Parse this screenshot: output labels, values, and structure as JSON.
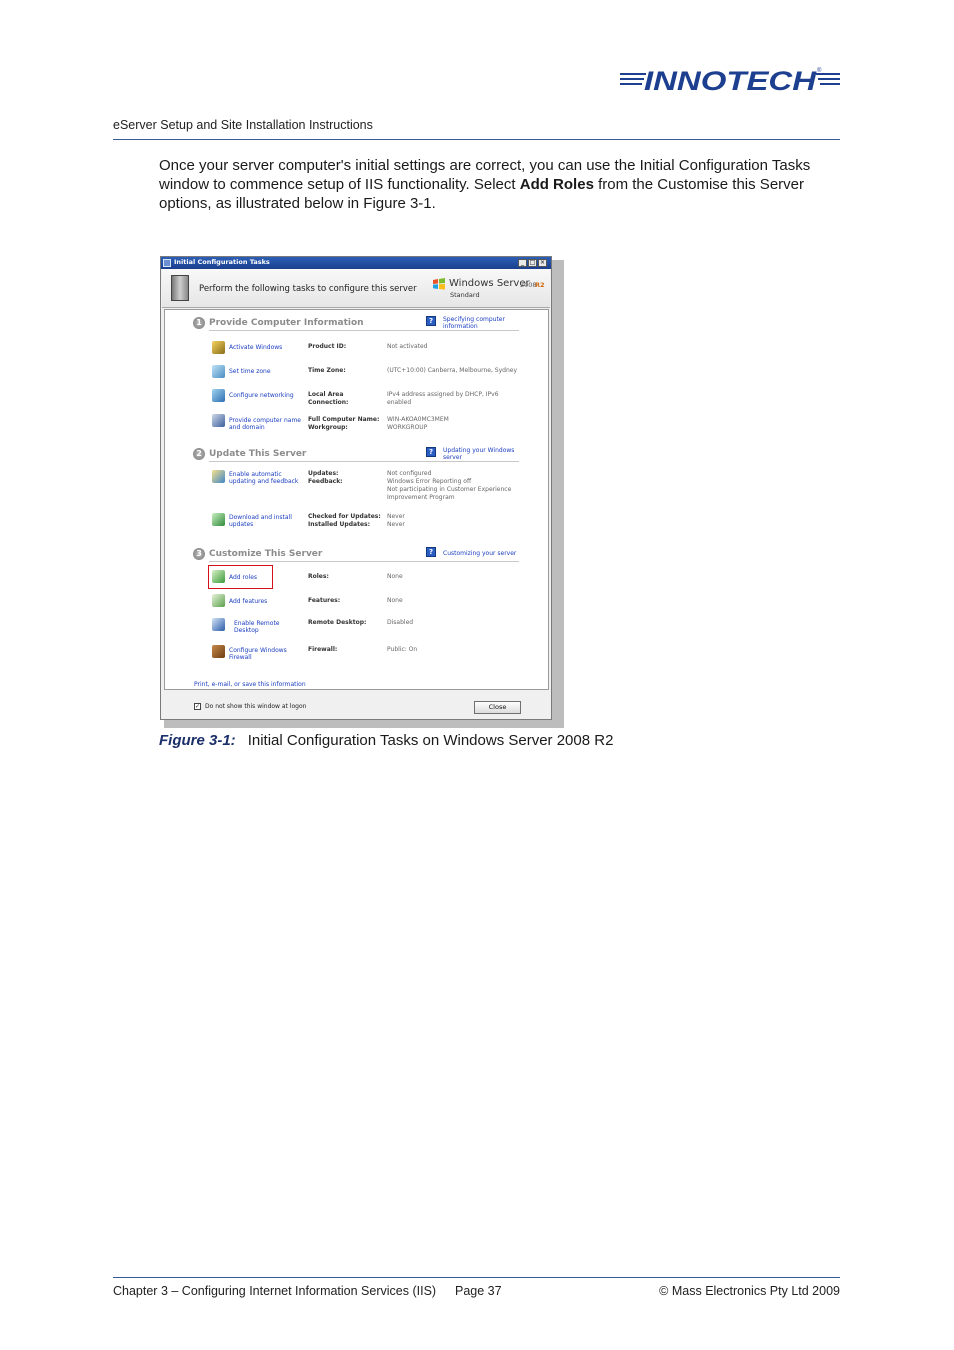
{
  "header": {
    "logo_text": "INNOTECH",
    "doc_title": "eServer Setup and Site Installation Instructions"
  },
  "intro": {
    "part1": "Once your server computer's initial settings are correct, you can use the Initial Configuration Tasks window to commence setup of IIS functionality.  Select ",
    "bold": "Add Roles",
    "part2": " from the Customise this Server options, as illustrated below in Figure 3-1."
  },
  "window": {
    "title": "Initial Configuration Tasks",
    "banner_text": "Perform the following tasks to configure this server",
    "brand_name": "Windows Server",
    "brand_version": "2008",
    "brand_release": "R2",
    "brand_edition": "Standard",
    "sections": [
      {
        "number": "1",
        "title": "Provide Computer Information",
        "help": "Specifying computer information",
        "tasks": [
          {
            "link": "Activate Windows",
            "label": "Product ID:",
            "value": "Not activated"
          },
          {
            "link": "Set time zone",
            "label": "Time Zone:",
            "value": "(UTC+10:00) Canberra, Melbourne, Sydney"
          },
          {
            "link": "Configure networking",
            "label": "Local Area\nConnection:",
            "value": "IPv4 address assigned by DHCP, IPv6\nenabled"
          },
          {
            "link": "Provide computer name and domain",
            "label": "Full Computer Name:\nWorkgroup:",
            "value": "WIN-AKOA0MC3MEM\nWORKGROUP"
          }
        ]
      },
      {
        "number": "2",
        "title": "Update This Server",
        "help": "Updating your Windows server",
        "tasks": [
          {
            "link": "Enable automatic updating and feedback",
            "label": "Updates:\nFeedback:",
            "value": "Not configured\nWindows Error Reporting off\nNot participating in Customer Experience\nImprovement Program"
          },
          {
            "link": "Download and install updates",
            "label": "Checked for Updates:\nInstalled Updates:",
            "value": "Never\nNever"
          }
        ]
      },
      {
        "number": "3",
        "title": "Customize This Server",
        "help": "Customizing your server",
        "tasks": [
          {
            "link": "Add roles",
            "label": "Roles:",
            "value": "None"
          },
          {
            "link": "Add features",
            "label": "Features:",
            "value": "None"
          },
          {
            "link": "Enable Remote Desktop",
            "label": "Remote Desktop:",
            "value": "Disabled"
          },
          {
            "link": "Configure Windows Firewall",
            "label": "Firewall:",
            "value": "Public: On"
          }
        ]
      }
    ],
    "print_link": "Print, e-mail, or save this information",
    "checkbox_label": "Do not show this window at logon",
    "close_label": "Close"
  },
  "caption": {
    "figure": "Figure 3-1:",
    "text": "Initial Configuration Tasks on Windows Server 2008 R2"
  },
  "footer": {
    "chapter": "Chapter 3 – Configuring Internet Information Services (IIS)",
    "page": "Page 37",
    "copyright": "©  Mass Electronics Pty Ltd  2009"
  },
  "colors": {
    "accent": "#3a5a9a",
    "logo": "#1d3f8f",
    "link": "#1a3dc0",
    "highlight": "#d4101a"
  }
}
